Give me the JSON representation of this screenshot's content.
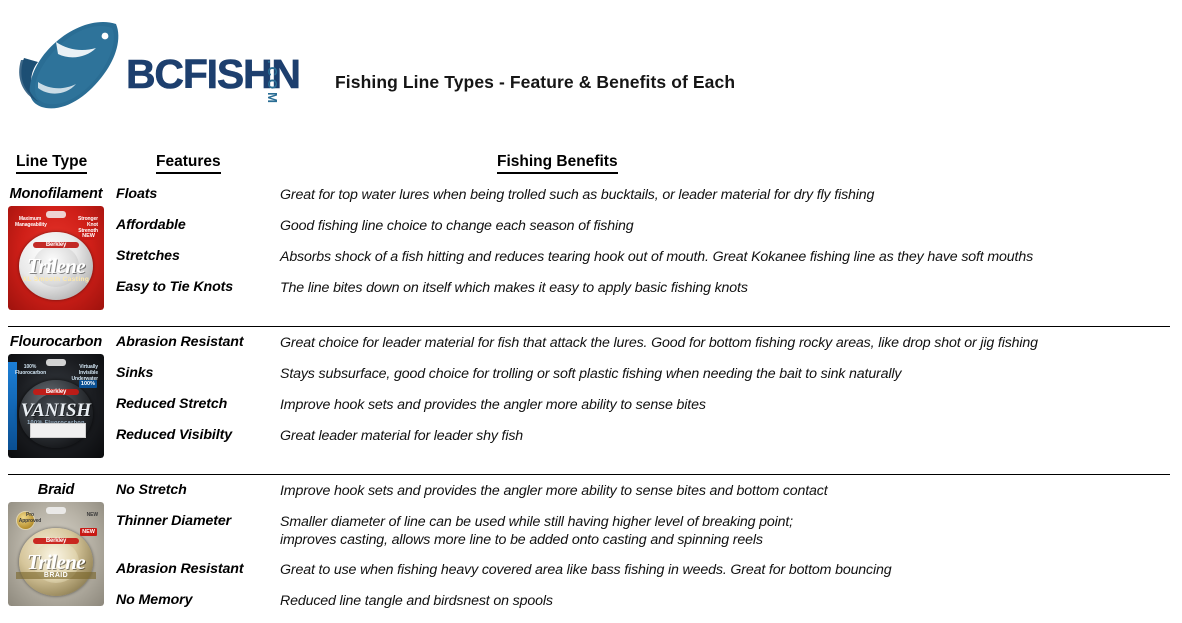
{
  "header": {
    "brand_name": "BCFISHN",
    "brand_suffix": ".COM",
    "logo_icon": "fish-logo-icon",
    "title": "Fishing Line Types - Feature & Benefits of Each",
    "colors": {
      "fish_blue": "#2a6d94",
      "wordmark_navy": "#1d3f6e"
    }
  },
  "table": {
    "columns": [
      {
        "label": "Line Type "
      },
      {
        "label": "Features "
      },
      {
        "label": "Fishing Benefits"
      }
    ],
    "sections": [
      {
        "type_name": "Monofilament",
        "product": {
          "name": "Berkley Trilene XL",
          "brand": "Berkley",
          "script": "Trilene",
          "sub": "XL Smooth Casting",
          "corner_left": "Maximum Manageability",
          "corner_right": "Stronger Knot Strength",
          "badge": "NEW",
          "package_color": "#cf1f18"
        },
        "rows": [
          {
            "feature": "Floats",
            "benefit": "Great for top water lures when being trolled such as bucktails, or leader material for dry fly fishing"
          },
          {
            "feature": "Affordable",
            "benefit": "Good fishing line choice to change each season of fishing"
          },
          {
            "feature": "Stretches",
            "benefit": "Absorbs shock of a fish hitting and reduces tearing hook out of mouth. Great Kokanee fishing line as they have soft mouths"
          },
          {
            "feature": "Easy to Tie Knots",
            "benefit": "The line bites down on itself which makes it easy to apply basic fishing knots"
          }
        ]
      },
      {
        "type_name": "Flourocarbon",
        "product": {
          "name": "Berkley Vanish",
          "brand": "Berkley",
          "script": "VANISH",
          "sub": "100% Fluorocarbon",
          "corner_left": "100% Fluorocarbon",
          "corner_right": "Virtually Invisible Underwater",
          "badge": "100%",
          "package_color": "#1b1d21"
        },
        "rows": [
          {
            "feature": "Abrasion Resistant",
            "benefit": "Great choice for leader material for fish that attack the lures. Good for bottom fishing rocky areas, like drop shot or jig fishing"
          },
          {
            "feature": "Sinks",
            "benefit": "Stays subsurface, good choice for trolling or soft plastic fishing when needing the bait to sink naturally"
          },
          {
            "feature": "Reduced Stretch",
            "benefit": "Improve hook sets and provides the angler more ability to sense bites"
          },
          {
            "feature": "Reduced Visibilty",
            "benefit": "Great leader material for leader shy fish"
          }
        ]
      },
      {
        "type_name": "Braid",
        "product": {
          "name": "Berkley Trilene Braid",
          "brand": "Berkley",
          "script": "Trilene",
          "sub": "BRAID",
          "corner_left": "Pro Approved",
          "corner_right": "NEW",
          "badge": "NEW",
          "package_color": "#b8b3a7"
        },
        "rows": [
          {
            "feature": "No Stretch",
            "benefit": "Improve hook sets and provides the angler more ability to sense bites and bottom contact"
          },
          {
            "feature": "Thinner Diameter",
            "benefit": "Smaller diameter of line can be used while still having higher level of breaking point;\n improves casting, allows more line to be added onto casting and spinning reels"
          },
          {
            "feature": "Abrasion Resistant",
            "benefit": "Great to use when fishing heavy covered area like bass fishing in weeds. Great for bottom bouncing"
          },
          {
            "feature": "No Memory",
            "benefit": "Reduced line tangle and birdsnest on spools"
          }
        ]
      }
    ]
  }
}
